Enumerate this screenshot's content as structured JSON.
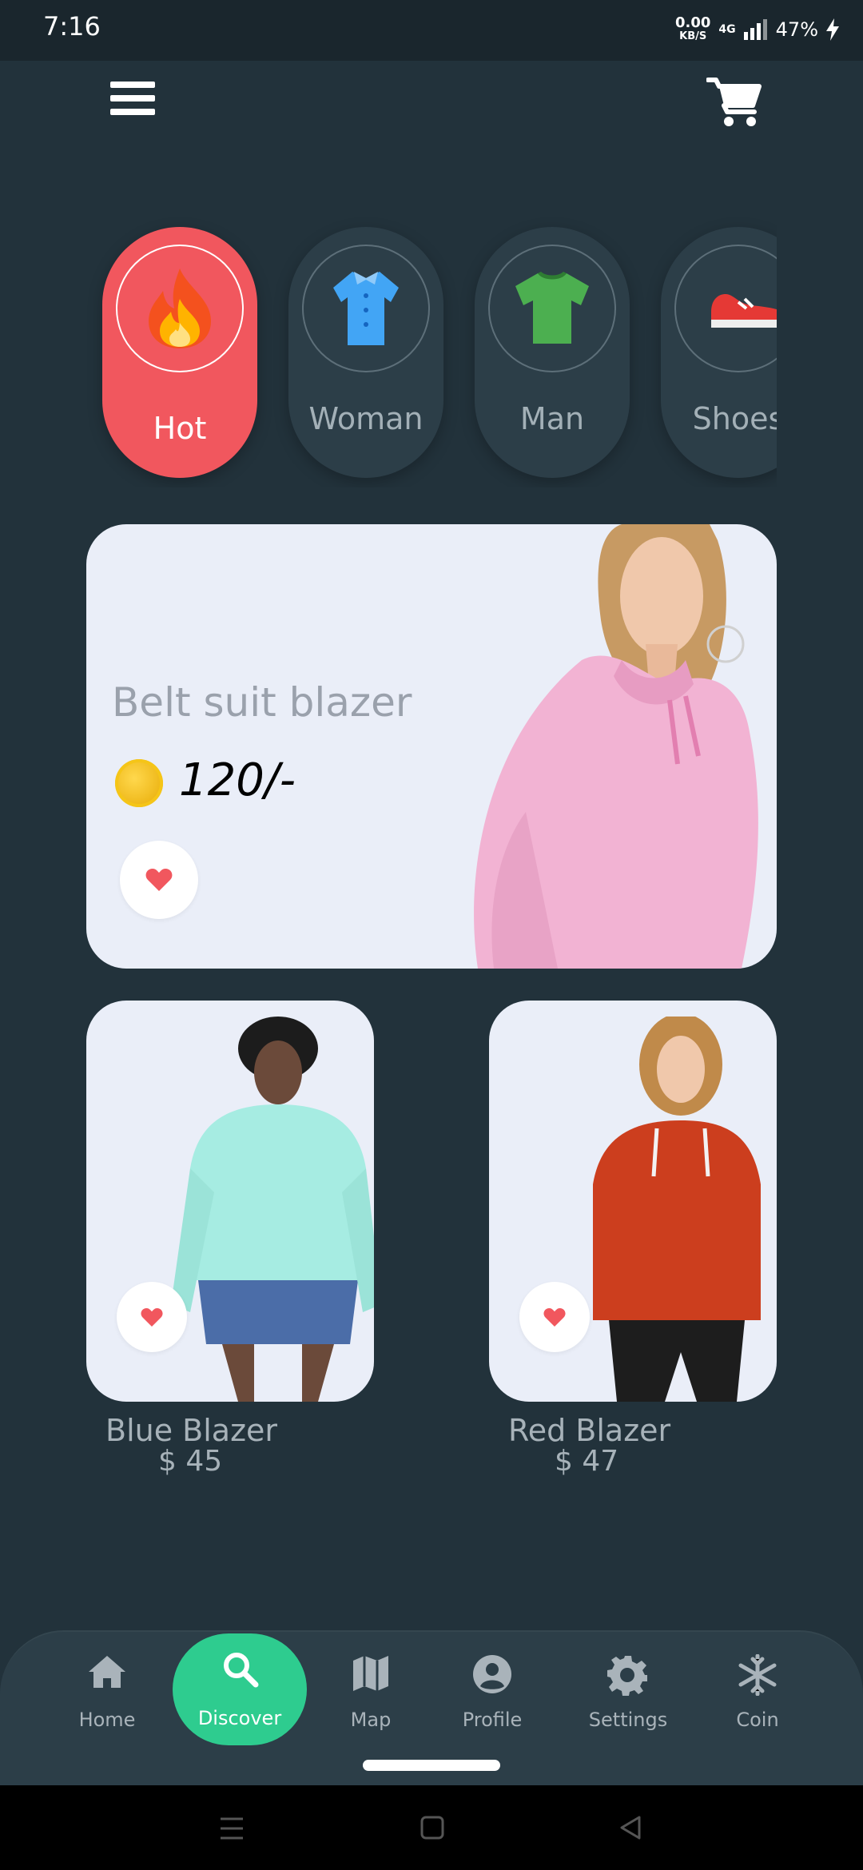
{
  "status_bar": {
    "time": "7:16",
    "speed": "0.00",
    "speed_unit": "KB/S",
    "network": "4G",
    "battery": "47%"
  },
  "categories": [
    {
      "label": "Hot",
      "icon": "fire-icon",
      "active": true
    },
    {
      "label": "Woman",
      "icon": "blouse-icon",
      "active": false
    },
    {
      "label": "Man",
      "icon": "tshirt-icon",
      "active": false
    },
    {
      "label": "Shoes",
      "icon": "sneaker-icon",
      "active": false
    }
  ],
  "featured": {
    "title": "Belt suit blazer",
    "price": "120/-"
  },
  "products": [
    {
      "name": "Blue Blazer",
      "price": "$ 45"
    },
    {
      "name": "Red Blazer",
      "price": "$ 47"
    }
  ],
  "bottom_nav": [
    {
      "label": "Home",
      "icon": "home-icon"
    },
    {
      "label": "Discover",
      "icon": "search-icon",
      "active": true
    },
    {
      "label": "Map",
      "icon": "map-icon"
    },
    {
      "label": "Profile",
      "icon": "profile-icon"
    },
    {
      "label": "Settings",
      "icon": "gear-icon"
    },
    {
      "label": "Coin",
      "icon": "snowflake-icon"
    }
  ],
  "colors": {
    "background": "#22323b",
    "accent_hot": "#f1575e",
    "accent_nav": "#2ecc8f",
    "heart": "#f1575e"
  }
}
